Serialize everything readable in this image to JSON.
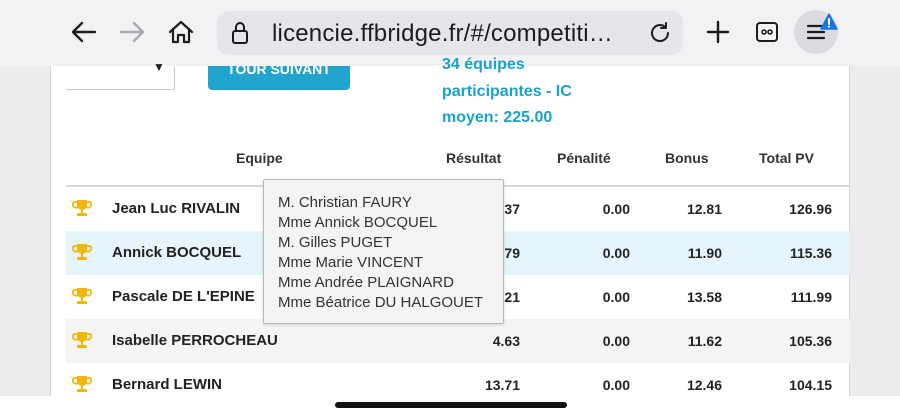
{
  "browser": {
    "url": "licencie.ffbridge.fr/#/competiti…",
    "icons": [
      "back-arrow-icon",
      "forward-arrow-icon",
      "home-icon",
      "lock-icon",
      "reload-icon",
      "new-tab-plus-icon",
      "tabs-icon",
      "menu-icon",
      "warning-badge-icon"
    ]
  },
  "page": {
    "next_round_button": "TOUR SUIVANT",
    "info": [
      "34 équipes",
      "participantes - IC",
      "moyen: 225.00"
    ]
  },
  "table": {
    "headers": {
      "team": "Equipe",
      "result": "Résultat",
      "penalty": "Pénalité",
      "bonus": "Bonus",
      "total": "Total PV"
    },
    "rows": [
      {
        "team": "Jean Luc RIVALIN",
        "result": "…37",
        "penalty": "0.00",
        "bonus": "12.81",
        "total": "126.96"
      },
      {
        "team": "Annick BOCQUEL",
        "result": "…79",
        "penalty": "0.00",
        "bonus": "11.90",
        "total": "115.36"
      },
      {
        "team": "Pascale DE L'EPINE",
        "result": "…21",
        "penalty": "0.00",
        "bonus": "13.58",
        "total": "111.99"
      },
      {
        "team": "Isabelle PERROCHEAU",
        "result": "4.63",
        "penalty": "0.00",
        "bonus": "11.62",
        "total": "105.36"
      },
      {
        "team": "Bernard LEWIN",
        "result": "13.71",
        "penalty": "0.00",
        "bonus": "12.46",
        "total": "104.15"
      }
    ]
  },
  "tooltip": {
    "members": [
      "M. Christian FAURY",
      "Mme Annick BOCQUEL",
      "M. Gilles PUGET",
      "Mme Marie VINCENT",
      "Mme Andrée PLAIGNARD",
      "Mme Béatrice DU HALGOUET"
    ]
  },
  "colors": {
    "accent": "#21a5cf",
    "trophy": "#f2b705",
    "highlight_row": "#e6f5fb"
  }
}
